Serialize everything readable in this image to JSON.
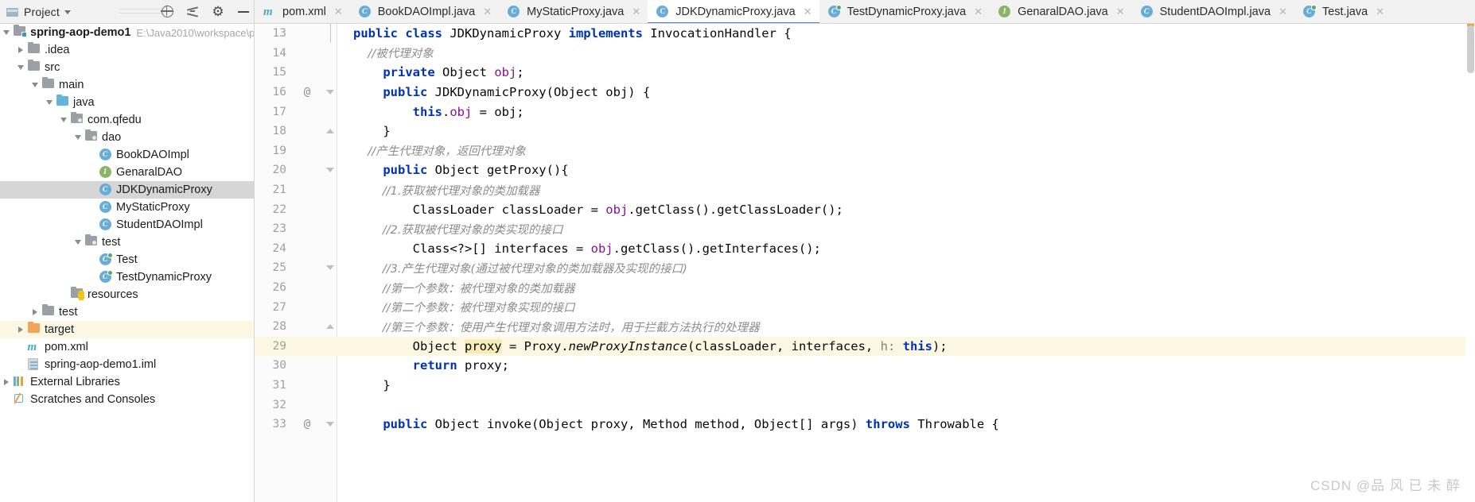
{
  "toolwindow": {
    "title": "Project",
    "icons": {
      "project_icon": "project-icon",
      "dropdown": "chevron-down-icon",
      "globe": "globe-icon",
      "collapse_all": "collapse-all-icon",
      "settings": "gear-icon",
      "hide": "minimize-icon"
    }
  },
  "tree": [
    {
      "label": "spring-aop-demo1",
      "path": "E:\\Java2010\\workspace\\p",
      "indent": 0,
      "arrow": "down",
      "icon": "module-folder",
      "bold": true,
      "state": "normal"
    },
    {
      "label": ".idea",
      "path": "",
      "indent": 1,
      "arrow": "right",
      "icon": "folder-gray",
      "bold": false,
      "state": "normal"
    },
    {
      "label": "src",
      "path": "",
      "indent": 1,
      "arrow": "down",
      "icon": "folder-gray",
      "bold": false,
      "state": "normal"
    },
    {
      "label": "main",
      "path": "",
      "indent": 2,
      "arrow": "down",
      "icon": "folder-gray",
      "bold": false,
      "state": "normal"
    },
    {
      "label": "java",
      "path": "",
      "indent": 3,
      "arrow": "down",
      "icon": "folder-source",
      "bold": false,
      "state": "normal"
    },
    {
      "label": "com.qfedu",
      "path": "",
      "indent": 4,
      "arrow": "down",
      "icon": "package",
      "bold": false,
      "state": "normal"
    },
    {
      "label": "dao",
      "path": "",
      "indent": 5,
      "arrow": "down",
      "icon": "package",
      "bold": false,
      "state": "normal"
    },
    {
      "label": "BookDAOImpl",
      "path": "",
      "indent": 6,
      "arrow": "none",
      "icon": "class",
      "bold": false,
      "state": "normal"
    },
    {
      "label": "GenaralDAO",
      "path": "",
      "indent": 6,
      "arrow": "none",
      "icon": "interface",
      "bold": false,
      "state": "normal"
    },
    {
      "label": "JDKDynamicProxy",
      "path": "",
      "indent": 6,
      "arrow": "none",
      "icon": "class",
      "bold": false,
      "state": "selected"
    },
    {
      "label": "MyStaticProxy",
      "path": "",
      "indent": 6,
      "arrow": "none",
      "icon": "class",
      "bold": false,
      "state": "normal"
    },
    {
      "label": "StudentDAOImpl",
      "path": "",
      "indent": 6,
      "arrow": "none",
      "icon": "class",
      "bold": false,
      "state": "normal"
    },
    {
      "label": "test",
      "path": "",
      "indent": 5,
      "arrow": "down",
      "icon": "package",
      "bold": false,
      "state": "normal"
    },
    {
      "label": "Test",
      "path": "",
      "indent": 6,
      "arrow": "none",
      "icon": "test-class",
      "bold": false,
      "state": "normal"
    },
    {
      "label": "TestDynamicProxy",
      "path": "",
      "indent": 6,
      "arrow": "none",
      "icon": "test-class",
      "bold": false,
      "state": "normal"
    },
    {
      "label": "resources",
      "path": "",
      "indent": 4,
      "arrow": "none",
      "icon": "folder-resources",
      "bold": false,
      "state": "normal"
    },
    {
      "label": "test",
      "path": "",
      "indent": 2,
      "arrow": "right",
      "icon": "folder-gray",
      "bold": false,
      "state": "normal"
    },
    {
      "label": "target",
      "path": "",
      "indent": 1,
      "arrow": "right",
      "icon": "folder-orange",
      "bold": false,
      "state": "highlighted"
    },
    {
      "label": "pom.xml",
      "path": "",
      "indent": 1,
      "arrow": "none",
      "icon": "maven",
      "bold": false,
      "state": "normal"
    },
    {
      "label": "spring-aop-demo1.iml",
      "path": "",
      "indent": 1,
      "arrow": "none",
      "icon": "iml",
      "bold": false,
      "state": "normal"
    },
    {
      "label": "External Libraries",
      "path": "",
      "indent": 0,
      "arrow": "right",
      "icon": "libraries",
      "bold": false,
      "state": "normal"
    },
    {
      "label": "Scratches and Consoles",
      "path": "",
      "indent": 0,
      "arrow": "none",
      "icon": "scratches",
      "bold": false,
      "state": "normal"
    }
  ],
  "tabs": [
    {
      "label": "pom.xml",
      "icon": "maven",
      "active": false,
      "closable": true
    },
    {
      "label": "BookDAOImpl.java",
      "icon": "class",
      "active": false,
      "closable": true
    },
    {
      "label": "MyStaticProxy.java",
      "icon": "class",
      "active": false,
      "closable": true
    },
    {
      "label": "JDKDynamicProxy.java",
      "icon": "class",
      "active": true,
      "closable": true
    },
    {
      "label": "TestDynamicProxy.java",
      "icon": "test-class",
      "active": false,
      "closable": true
    },
    {
      "label": "GenaralDAO.java",
      "icon": "interface",
      "active": false,
      "closable": true
    },
    {
      "label": "StudentDAOImpl.java",
      "icon": "class",
      "active": false,
      "closable": true
    },
    {
      "label": "Test.java",
      "icon": "test-class",
      "active": false,
      "closable": true
    }
  ],
  "code": {
    "lines": [
      {
        "num": "13",
        "mark": "",
        "fold": "bar",
        "tokens": [
          {
            "t": "public ",
            "c": "kw"
          },
          {
            "t": "class ",
            "c": "kw"
          },
          {
            "t": "JDKDynamicProxy ",
            "c": "pl"
          },
          {
            "t": "implements ",
            "c": "kw"
          },
          {
            "t": "InvocationHandler {",
            "c": "pl"
          }
        ]
      },
      {
        "num": "14",
        "mark": "",
        "fold": "",
        "tokens": [
          {
            "t": "    //被代理对象",
            "c": "cm"
          }
        ]
      },
      {
        "num": "15",
        "mark": "",
        "fold": "",
        "tokens": [
          {
            "t": "    ",
            "c": "pl"
          },
          {
            "t": "private ",
            "c": "kw"
          },
          {
            "t": "Object ",
            "c": "pl"
          },
          {
            "t": "obj",
            "c": "fld"
          },
          {
            "t": ";",
            "c": "pl"
          }
        ]
      },
      {
        "num": "16",
        "mark": "@",
        "fold": "ar-down",
        "tokens": [
          {
            "t": "    ",
            "c": "pl"
          },
          {
            "t": "public ",
            "c": "kw"
          },
          {
            "t": "JDKDynamicProxy(Object obj) {",
            "c": "pl"
          }
        ]
      },
      {
        "num": "17",
        "mark": "",
        "fold": "",
        "tokens": [
          {
            "t": "        ",
            "c": "pl"
          },
          {
            "t": "this",
            "c": "kw"
          },
          {
            "t": ".",
            "c": "pl"
          },
          {
            "t": "obj",
            "c": "fld"
          },
          {
            "t": " = obj;",
            "c": "pl"
          }
        ]
      },
      {
        "num": "18",
        "mark": "",
        "fold": "ar-up",
        "tokens": [
          {
            "t": "    }",
            "c": "pl"
          }
        ]
      },
      {
        "num": "19",
        "mark": "",
        "fold": "",
        "tokens": [
          {
            "t": "    //产生代理对象，返回代理对象",
            "c": "cm"
          }
        ]
      },
      {
        "num": "20",
        "mark": "",
        "fold": "ar-down",
        "tokens": [
          {
            "t": "    ",
            "c": "pl"
          },
          {
            "t": "public ",
            "c": "kw"
          },
          {
            "t": "Object getProxy(){",
            "c": "pl"
          }
        ]
      },
      {
        "num": "21",
        "mark": "",
        "fold": "",
        "tokens": [
          {
            "t": "        //1.获取被代理对象的类加载器",
            "c": "cm"
          }
        ]
      },
      {
        "num": "22",
        "mark": "",
        "fold": "",
        "tokens": [
          {
            "t": "        ClassLoader classLoader = ",
            "c": "pl"
          },
          {
            "t": "obj",
            "c": "fld"
          },
          {
            "t": ".getClass().getClassLoader();",
            "c": "pl"
          }
        ]
      },
      {
        "num": "23",
        "mark": "",
        "fold": "",
        "tokens": [
          {
            "t": "        //2.获取被代理对象的类实现的接口",
            "c": "cm"
          }
        ]
      },
      {
        "num": "24",
        "mark": "",
        "fold": "",
        "tokens": [
          {
            "t": "        Class<?>[] interfaces = ",
            "c": "pl"
          },
          {
            "t": "obj",
            "c": "fld"
          },
          {
            "t": ".getClass().getInterfaces();",
            "c": "pl"
          }
        ]
      },
      {
        "num": "25",
        "mark": "",
        "fold": "ar-down",
        "tokens": [
          {
            "t": "        //3.产生代理对象(通过被代理对象的类加载器及实现的接口)",
            "c": "cm"
          }
        ]
      },
      {
        "num": "26",
        "mark": "",
        "fold": "",
        "tokens": [
          {
            "t": "        //第一个参数：被代理对象的类加载器",
            "c": "cm"
          }
        ]
      },
      {
        "num": "27",
        "mark": "",
        "fold": "",
        "tokens": [
          {
            "t": "        //第二个参数：被代理对象实现的接口",
            "c": "cm"
          }
        ]
      },
      {
        "num": "28",
        "mark": "",
        "fold": "ar-up",
        "tokens": [
          {
            "t": "        //第三个参数：使用产生代理对象调用方法时，用于拦截方法执行的处理器",
            "c": "cm"
          }
        ]
      },
      {
        "num": "29",
        "mark": "",
        "fold": "",
        "highlight": true,
        "tokens": [
          {
            "t": "        Object ",
            "c": "pl"
          },
          {
            "t": "proxy",
            "c": "hlw"
          },
          {
            "t": " = Proxy.",
            "c": "pl"
          },
          {
            "t": "newProxyInstance",
            "c": "mth"
          },
          {
            "t": "(classLoader, interfaces, ",
            "c": "pl"
          },
          {
            "t": "h:",
            "c": "param"
          },
          {
            "t": " ",
            "c": "pl"
          },
          {
            "t": "this",
            "c": "kw"
          },
          {
            "t": ");",
            "c": "pl"
          }
        ]
      },
      {
        "num": "30",
        "mark": "",
        "fold": "",
        "tokens": [
          {
            "t": "        ",
            "c": "pl"
          },
          {
            "t": "return ",
            "c": "kw"
          },
          {
            "t": "proxy;",
            "c": "pl"
          }
        ]
      },
      {
        "num": "31",
        "mark": "",
        "fold": "",
        "tokens": [
          {
            "t": "    }",
            "c": "pl"
          }
        ]
      },
      {
        "num": "32",
        "mark": "",
        "fold": "",
        "tokens": [
          {
            "t": "",
            "c": "pl"
          }
        ]
      },
      {
        "num": "33",
        "mark": "@",
        "fold": "ar-down",
        "tokens": [
          {
            "t": "    ",
            "c": "pl"
          },
          {
            "t": "public ",
            "c": "kw"
          },
          {
            "t": "Object invoke(Object proxy, Method method, Object[] args) ",
            "c": "pl"
          },
          {
            "t": "throws ",
            "c": "kw"
          },
          {
            "t": "Throwable {",
            "c": "pl"
          }
        ]
      }
    ]
  },
  "watermark": "CSDN @品 风 已 未 醉",
  "colors": {
    "keyword": "#0033b3",
    "comment": "#8c8c8c",
    "field": "#871094",
    "accent": "#4a86c8",
    "selection": "#d6d6d6",
    "highlight_row": "#fcf7e2",
    "class_badge": "#6aacd8",
    "interface_badge": "#8bb566",
    "maven_badge": "#4aa8c4"
  }
}
